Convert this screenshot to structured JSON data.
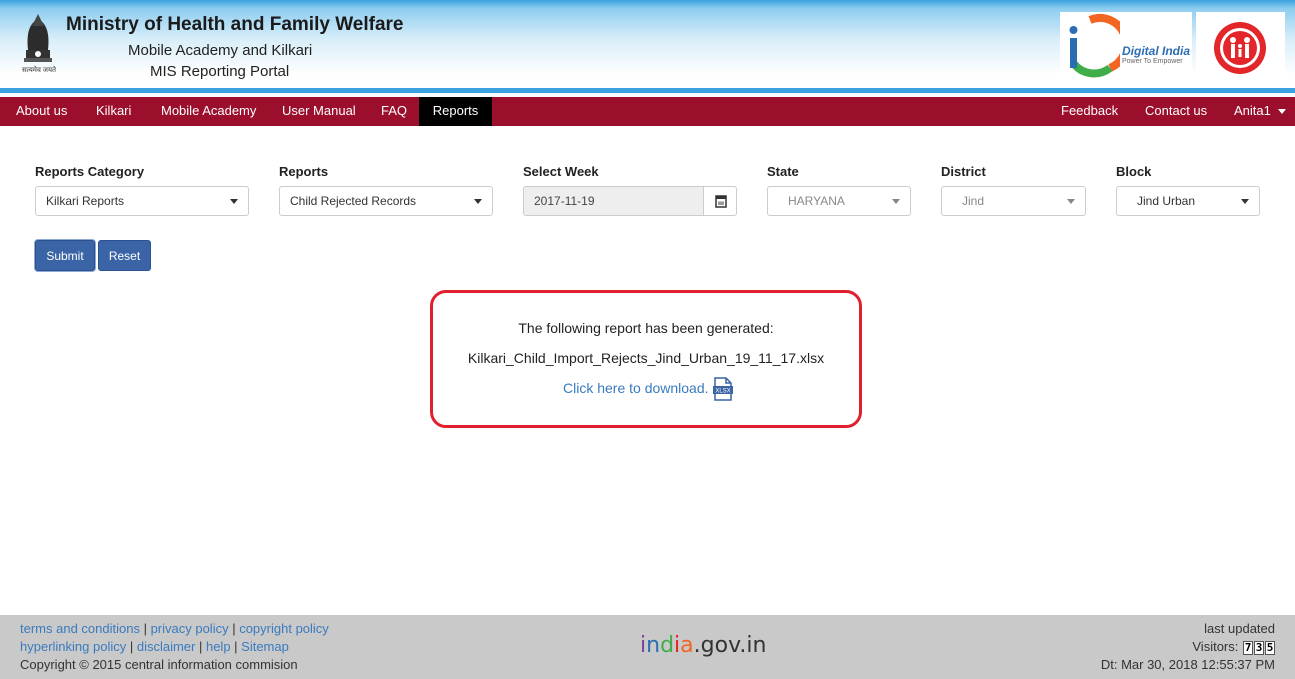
{
  "header": {
    "title": "Ministry of Health and Family Welfare",
    "subtitle1": "Mobile Academy and Kilkari",
    "subtitle2": "MIS Reporting Portal",
    "emblem_motto": "सत्यमेव जयते",
    "digital_india": "Digital India",
    "digital_india_tagline": "Power To Empower"
  },
  "nav": {
    "left": [
      "About us",
      "Kilkari",
      "Mobile Academy",
      "User Manual",
      "FAQ",
      "Reports"
    ],
    "active": "Reports",
    "right": [
      "Feedback",
      "Contact us",
      "Anita1"
    ]
  },
  "form": {
    "reports_category": {
      "label": "Reports Category",
      "value": "Kilkari Reports"
    },
    "reports": {
      "label": "Reports",
      "value": "Child Rejected Records"
    },
    "select_week": {
      "label": "Select Week",
      "value": "2017-11-19"
    },
    "state": {
      "label": "State",
      "value": "HARYANA"
    },
    "district": {
      "label": "District",
      "value": "Jind"
    },
    "block": {
      "label": "Block",
      "value": "Jind Urban"
    },
    "submit_label": "Submit",
    "reset_label": "Reset"
  },
  "result": {
    "message": "The following report has been generated:",
    "filename": "Kilkari_Child_Import_Rejects_Jind_Urban_19_11_17.xlsx",
    "download_link": "Click here to download.",
    "file_icon_label": "XLSX"
  },
  "footer": {
    "links_row1": [
      "terms and conditions",
      "privacy policy",
      "copyright policy"
    ],
    "links_row2": [
      "hyperlinking policy",
      "disclaimer",
      "help",
      "Sitemap"
    ],
    "copyright": "Copyright © 2015 central information commision",
    "india_gov": "india.gov.in",
    "last_updated": "last updated",
    "visitors_label": "Visitors:",
    "visitors_digits": [
      "7",
      "3",
      "5"
    ],
    "date_text": "Dt: Mar 30, 2018 12:55:37 PM"
  },
  "colors": {
    "nav_bg": "#9b0f2d",
    "button_bg": "#3a64a6",
    "highlight_border": "#e0202e",
    "link": "#3a7bbf"
  }
}
